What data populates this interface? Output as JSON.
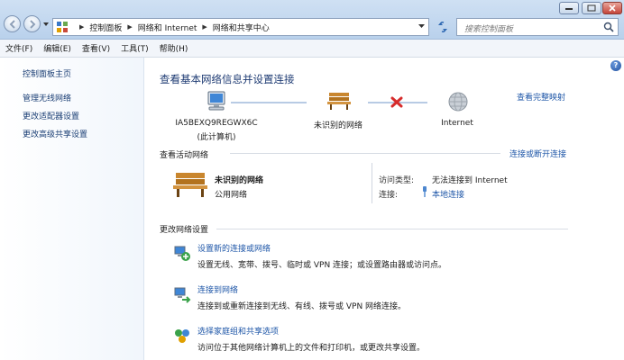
{
  "window": {
    "breadcrumb": [
      "控制面板",
      "网络和 Internet",
      "网络和共享中心"
    ],
    "search_placeholder": "搜索控制面板"
  },
  "menu": [
    "文件(F)",
    "编辑(E)",
    "查看(V)",
    "工具(T)",
    "帮助(H)"
  ],
  "sidebar": {
    "home": "控制面板主页",
    "items": [
      "管理无线网络",
      "更改适配器设置",
      "更改高级共享设置"
    ]
  },
  "main": {
    "title": "查看基本网络信息并设置连接",
    "view_full_map": "查看完整映射",
    "map": {
      "computer_name": "IA5BEXQ9REGWX6C",
      "computer_sub": "(此计算机)",
      "network_name": "未识别的网络",
      "internet": "Internet"
    },
    "active_networks": {
      "label": "查看活动网络",
      "connect_link": "连接或断开连接",
      "network_name": "未识别的网络",
      "network_type": "公用网络",
      "access_type_label": "访问类型:",
      "access_type_value": "无法连接到 Internet",
      "connections_label": "连接:",
      "connections_value": "本地连接"
    },
    "change_settings": {
      "label": "更改网络设置",
      "tasks": [
        {
          "link": "设置新的连接或网络",
          "desc": "设置无线、宽带、拨号、临时或 VPN 连接；或设置路由器或访问点。"
        },
        {
          "link": "连接到网络",
          "desc": "连接到或重新连接到无线、有线、拨号或 VPN 网络连接。"
        },
        {
          "link": "选择家庭组和共享选项",
          "desc": "访问位于其他网络计算机上的文件和打印机，或更改共享设置。"
        }
      ]
    }
  },
  "colors": {
    "link": "#1f57a8",
    "title": "#1e3b73",
    "error_x": "#d62b2b"
  }
}
